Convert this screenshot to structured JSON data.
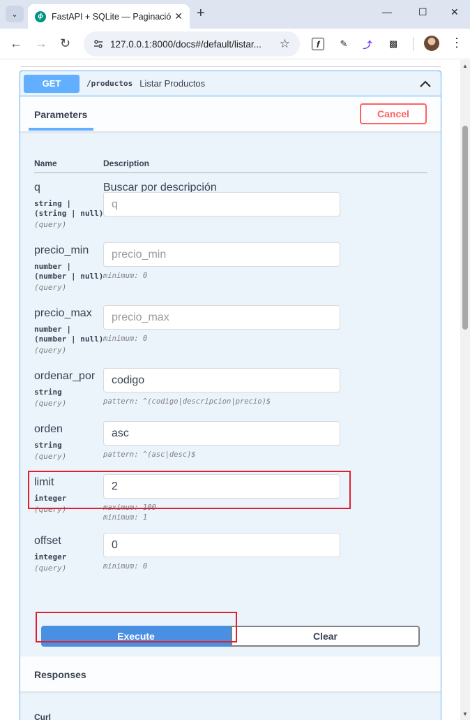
{
  "browser": {
    "tab_title": "FastAPI + SQLite — Paginación",
    "tab_favicon": "fastapi-logo-icon",
    "url": "127.0.0.1:8000/docs#/default/listar...",
    "window_controls": [
      "minimize-icon",
      "maximize-icon",
      "close-icon"
    ]
  },
  "operation": {
    "method": "GET",
    "path": "/productos",
    "summary": "Listar Productos",
    "parameters_tab": "Parameters",
    "cancel_label": "Cancel",
    "col_name": "Name",
    "col_description": "Description",
    "params": [
      {
        "name": "q",
        "type_lines": "string |\n(string | null)",
        "in": "(query)",
        "description": "Buscar por descripción",
        "value": "",
        "placeholder": "q",
        "constraints": ""
      },
      {
        "name": "precio_min",
        "type_lines": "number |\n(number | null)",
        "in": "(query)",
        "description": "",
        "value": "",
        "placeholder": "precio_min",
        "constraints": "minimum: 0"
      },
      {
        "name": "precio_max",
        "type_lines": "number |\n(number | null)",
        "in": "(query)",
        "description": "",
        "value": "",
        "placeholder": "precio_max",
        "constraints": "minimum: 0"
      },
      {
        "name": "ordenar_por",
        "type_lines": "string",
        "in": "(query)",
        "description": "",
        "value": "codigo",
        "placeholder": "",
        "constraints": "pattern: ^(codigo|descripcion|precio)$"
      },
      {
        "name": "orden",
        "type_lines": "string",
        "in": "(query)",
        "description": "",
        "value": "asc",
        "placeholder": "",
        "constraints": "pattern: ^(asc|desc)$"
      },
      {
        "name": "limit",
        "type_lines": "integer",
        "in": "(query)",
        "description": "",
        "value": "2",
        "placeholder": "",
        "constraints": "maximum: 100\nminimum: 1"
      },
      {
        "name": "offset",
        "type_lines": "integer",
        "in": "(query)",
        "description": "",
        "value": "0",
        "placeholder": "",
        "constraints": "minimum: 0"
      }
    ],
    "execute_label": "Execute",
    "clear_label": "Clear",
    "responses_title": "Responses",
    "curl_label": "Curl"
  },
  "colors": {
    "get_accent": "#61affe",
    "execute": "#4990e2",
    "cancel": "#ff6060",
    "annotation_red": "#e0202e"
  }
}
